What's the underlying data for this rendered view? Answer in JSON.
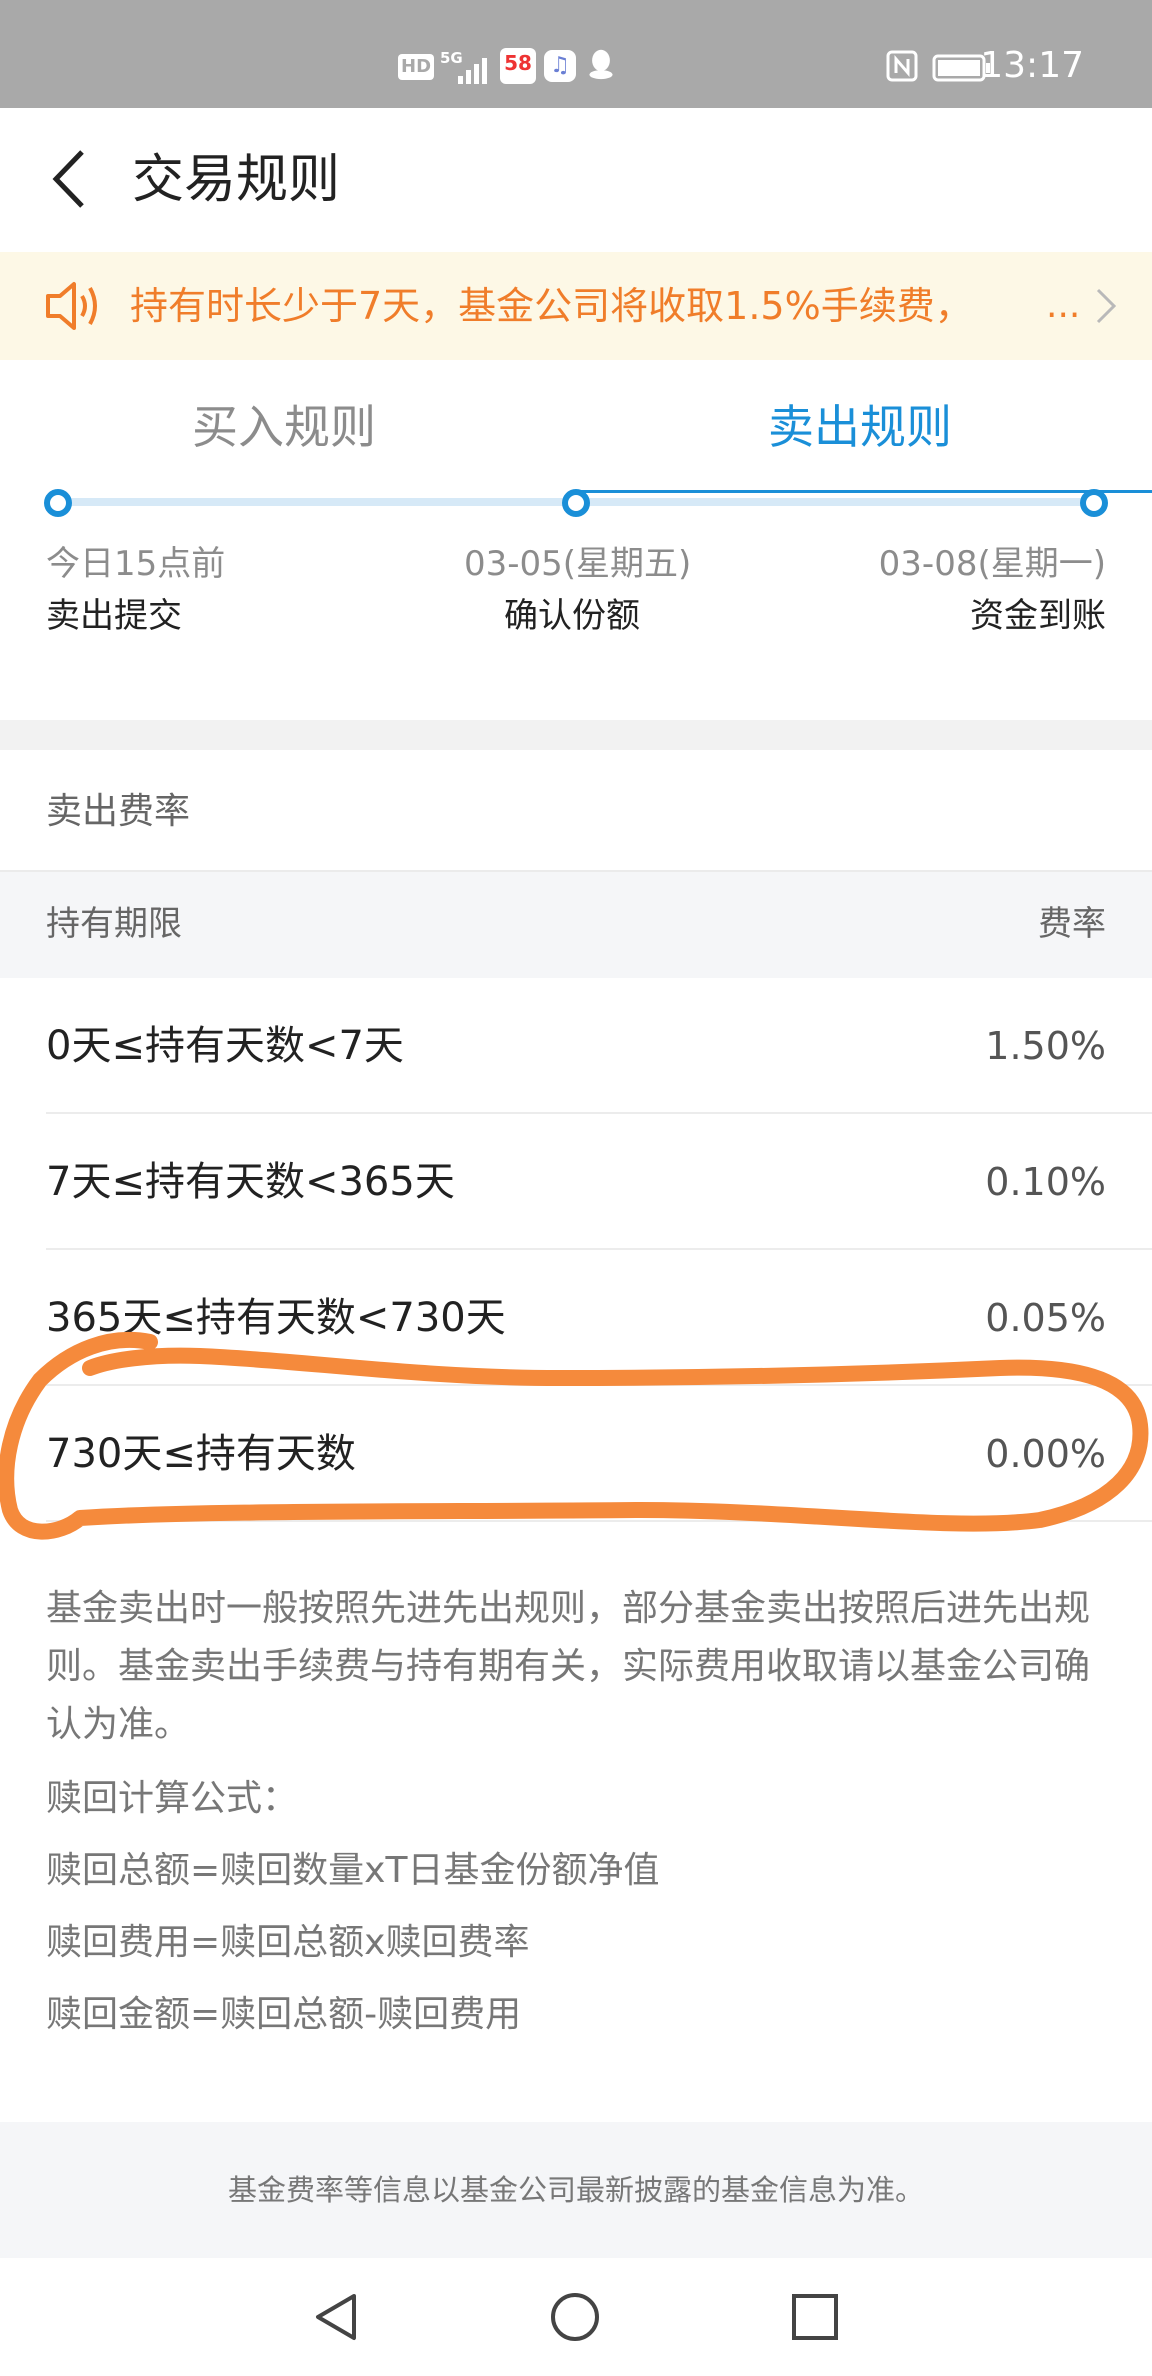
{
  "status_bar": {
    "left_icons": [
      "hd-icon",
      "5g-signal-icon",
      "app-58-icon",
      "music-icon",
      "qq-icon"
    ],
    "hd_label": "HD",
    "net_label": "5G",
    "app58_label": "58",
    "time": "13:17"
  },
  "header": {
    "title": "交易规则"
  },
  "notice": {
    "text": "持有时长少于7天，基金公司将收取1.5%手续费，",
    "ellipsis": "...",
    "color": "#f07d2a"
  },
  "tabs": [
    {
      "label": "买入规则",
      "active": false
    },
    {
      "label": "卖出规则",
      "active": true
    }
  ],
  "timeline": [
    {
      "date": "今日15点前",
      "step": "卖出提交"
    },
    {
      "date": "03-05(星期五)",
      "step": "确认份额"
    },
    {
      "date": "03-08(星期一)",
      "step": "资金到账"
    }
  ],
  "fee_section": {
    "title": "卖出费率",
    "col_period": "持有期限",
    "col_rate": "费率",
    "rows": [
      {
        "period": "0天≤持有天数<7天",
        "rate": "1.50%"
      },
      {
        "period": "7天≤持有天数<365天",
        "rate": "0.10%"
      },
      {
        "period": "365天≤持有天数<730天",
        "rate": "0.05%"
      },
      {
        "period": "730天≤持有天数",
        "rate": "0.00%"
      }
    ]
  },
  "notes": {
    "paragraph": "基金卖出时一般按照先进先出规则，部分基金卖出按照后进先出规则。基金卖出手续费与持有期有关，实际费用收取请以基金公司确认为准。",
    "formula_title": "赎回计算公式：",
    "formula_1": "赎回总额=赎回数量xT日基金份额净值",
    "formula_2": "赎回费用=赎回总额x赎回费率",
    "formula_3": "赎回金额=赎回总额-赎回费用"
  },
  "footer": {
    "text": "基金费率等信息以基金公司最新披露的基金信息为准。"
  },
  "colors": {
    "accent": "#1a8fd8",
    "highlight_circle": "#f58a3c",
    "notice_bg": "#fdf8e6"
  }
}
